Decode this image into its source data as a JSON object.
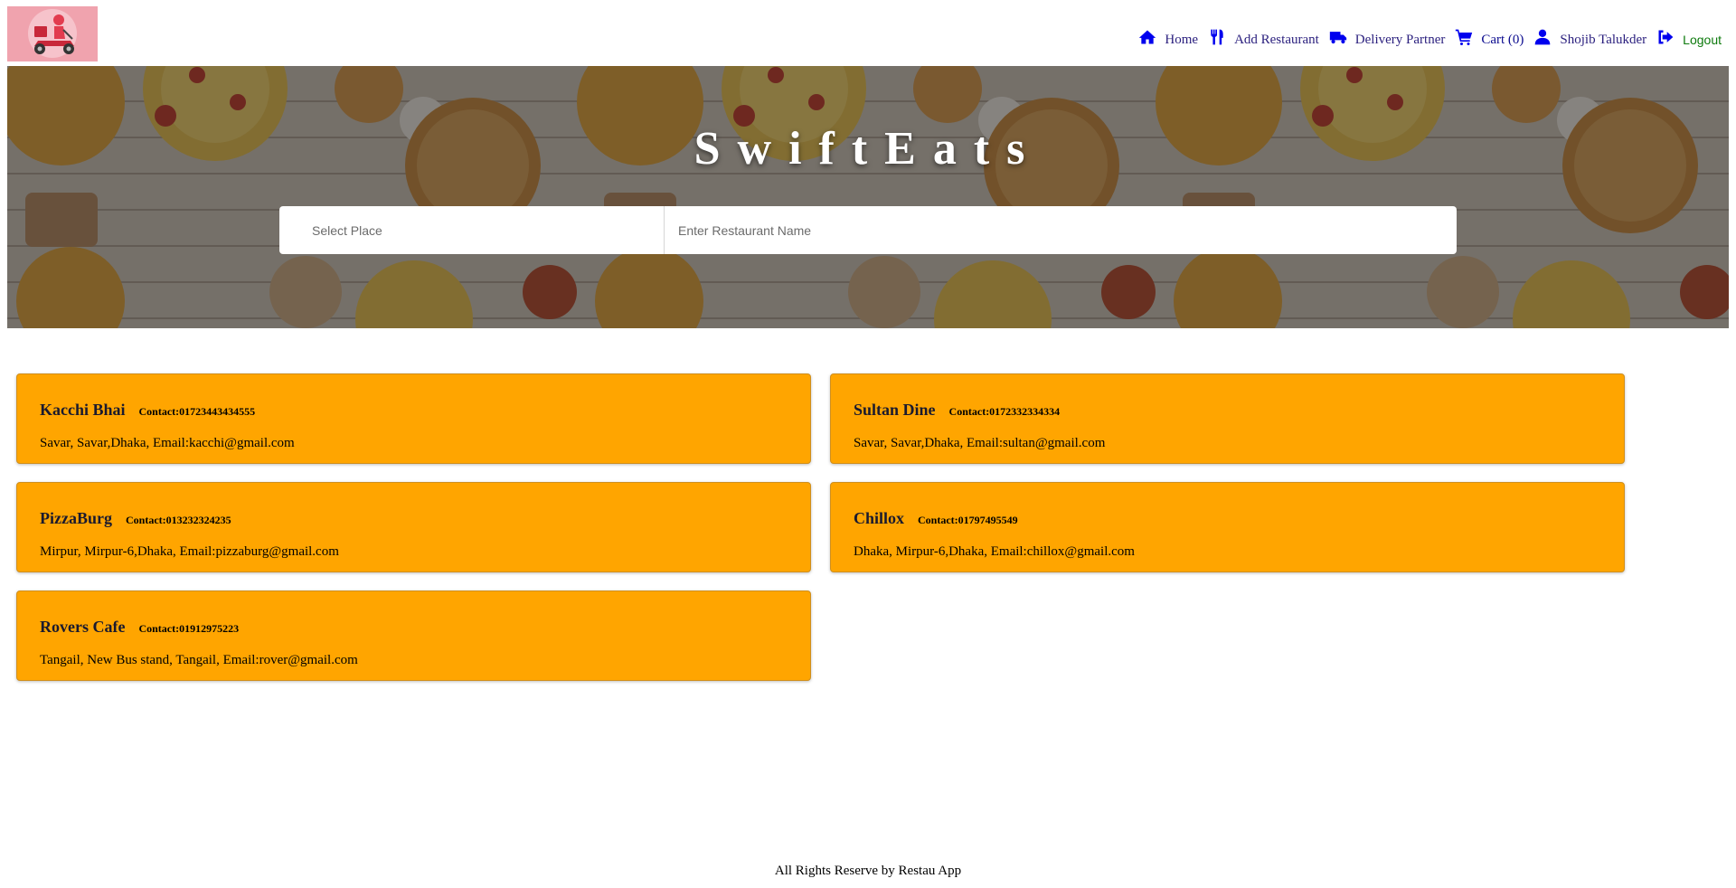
{
  "app": {
    "title": "SwiftEats",
    "brand_colors": {
      "card_bg": "#ffa500",
      "nav_icon": "#0000ee",
      "logout_text": "#0d7a0d",
      "logo_bg": "#f0a3ae"
    }
  },
  "header": {
    "logo_icon": "delivery-scooter-logo",
    "nav": [
      {
        "icon": "home-icon",
        "label": "Home"
      },
      {
        "icon": "utensils-icon",
        "label": "Add Restaurant"
      },
      {
        "icon": "truck-icon",
        "label": "Delivery Partner"
      },
      {
        "icon": "cart-icon",
        "label": "Cart (0)"
      },
      {
        "icon": "user-icon",
        "label": "Shojib Talukder"
      },
      {
        "icon": "logout-icon",
        "label": "Logout"
      }
    ]
  },
  "hero": {
    "title": "SwiftEats",
    "search": {
      "place_placeholder": "Select Place",
      "name_placeholder": "Enter Restaurant Name"
    }
  },
  "restaurants": [
    {
      "name": "Kacchi Bhai",
      "contact": "Contact:01723443434555",
      "address": "Savar, Savar,Dhaka, Email:kacchi@gmail.com"
    },
    {
      "name": "Sultan Dine",
      "contact": "Contact:0172332334334",
      "address": "Savar, Savar,Dhaka, Email:sultan@gmail.com"
    },
    {
      "name": "PizzaBurg",
      "contact": "Contact:013232324235",
      "address": "Mirpur, Mirpur-6,Dhaka, Email:pizzaburg@gmail.com"
    },
    {
      "name": "Chillox",
      "contact": "Contact:01797495549",
      "address": "Dhaka, Mirpur-6,Dhaka, Email:chillox@gmail.com"
    },
    {
      "name": "Rovers Cafe",
      "contact": "Contact:01912975223",
      "address": "Tangail, New Bus stand, Tangail, Email:rover@gmail.com"
    }
  ],
  "footer": {
    "text": "All Rights Reserve by Restau App"
  }
}
